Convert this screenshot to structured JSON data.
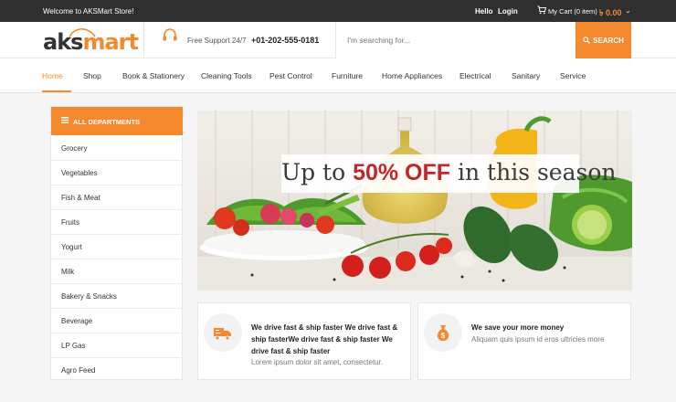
{
  "topbar": {
    "welcome": "Welcome to AKSMart Store!",
    "hello": "Hello",
    "login": "Login",
    "cart_label": "My Cart (0 item)",
    "cart_total": "৳ 0.00",
    "cart_icon": "cart-icon",
    "caret_icon": "chevron-down-icon"
  },
  "header": {
    "logo_part1": "aks",
    "logo_part2": "mart",
    "support_label": "Free Support 24/7",
    "support_phone": "+01-202-555-0181",
    "search_placeholder": "I'm searching for...",
    "search_button": "SEARCH",
    "support_icon": "headset-icon",
    "search_icon": "search-icon"
  },
  "nav": {
    "items": [
      {
        "label": "Home"
      },
      {
        "label": "Shop"
      },
      {
        "label": "Book & Stationery"
      },
      {
        "label": "Cleaning Tools"
      },
      {
        "label": "Pest Control"
      },
      {
        "label": "Furniture"
      },
      {
        "label": "Home Appliances"
      },
      {
        "label": "Electrical"
      },
      {
        "label": "Sanitary"
      },
      {
        "label": "Service"
      }
    ],
    "active_index": 0
  },
  "sidebar": {
    "header": "ALL DEPARTMENTS",
    "header_icon": "menu-icon",
    "items": [
      {
        "label": "Grocery"
      },
      {
        "label": "Vegetables"
      },
      {
        "label": "Fish & Meat"
      },
      {
        "label": "Fruits"
      },
      {
        "label": "Yogurt"
      },
      {
        "label": "Milk"
      },
      {
        "label": "Bakery & Snacks"
      },
      {
        "label": "Beverage"
      },
      {
        "label": "LP Gas"
      },
      {
        "label": "Agro Feed"
      }
    ]
  },
  "banner": {
    "prefix": "Up to ",
    "highlight": "50% OFF",
    "suffix": " in this season"
  },
  "features": [
    {
      "icon": "delivery-truck-icon",
      "title": "We drive fast & ship faster We drive fast & ship fasterWe drive fast & ship faster We drive fast & ship faster",
      "subtitle": "Lorem ipsum dolor sit amet, consectetur."
    },
    {
      "icon": "money-bag-icon",
      "title": "We save your more money",
      "subtitle": "Aliquam quis ipsum id eros ultricies more"
    }
  ],
  "colors": {
    "accent": "#f5892e",
    "topbar": "#2f2f2f",
    "highlight": "#c0272d"
  }
}
